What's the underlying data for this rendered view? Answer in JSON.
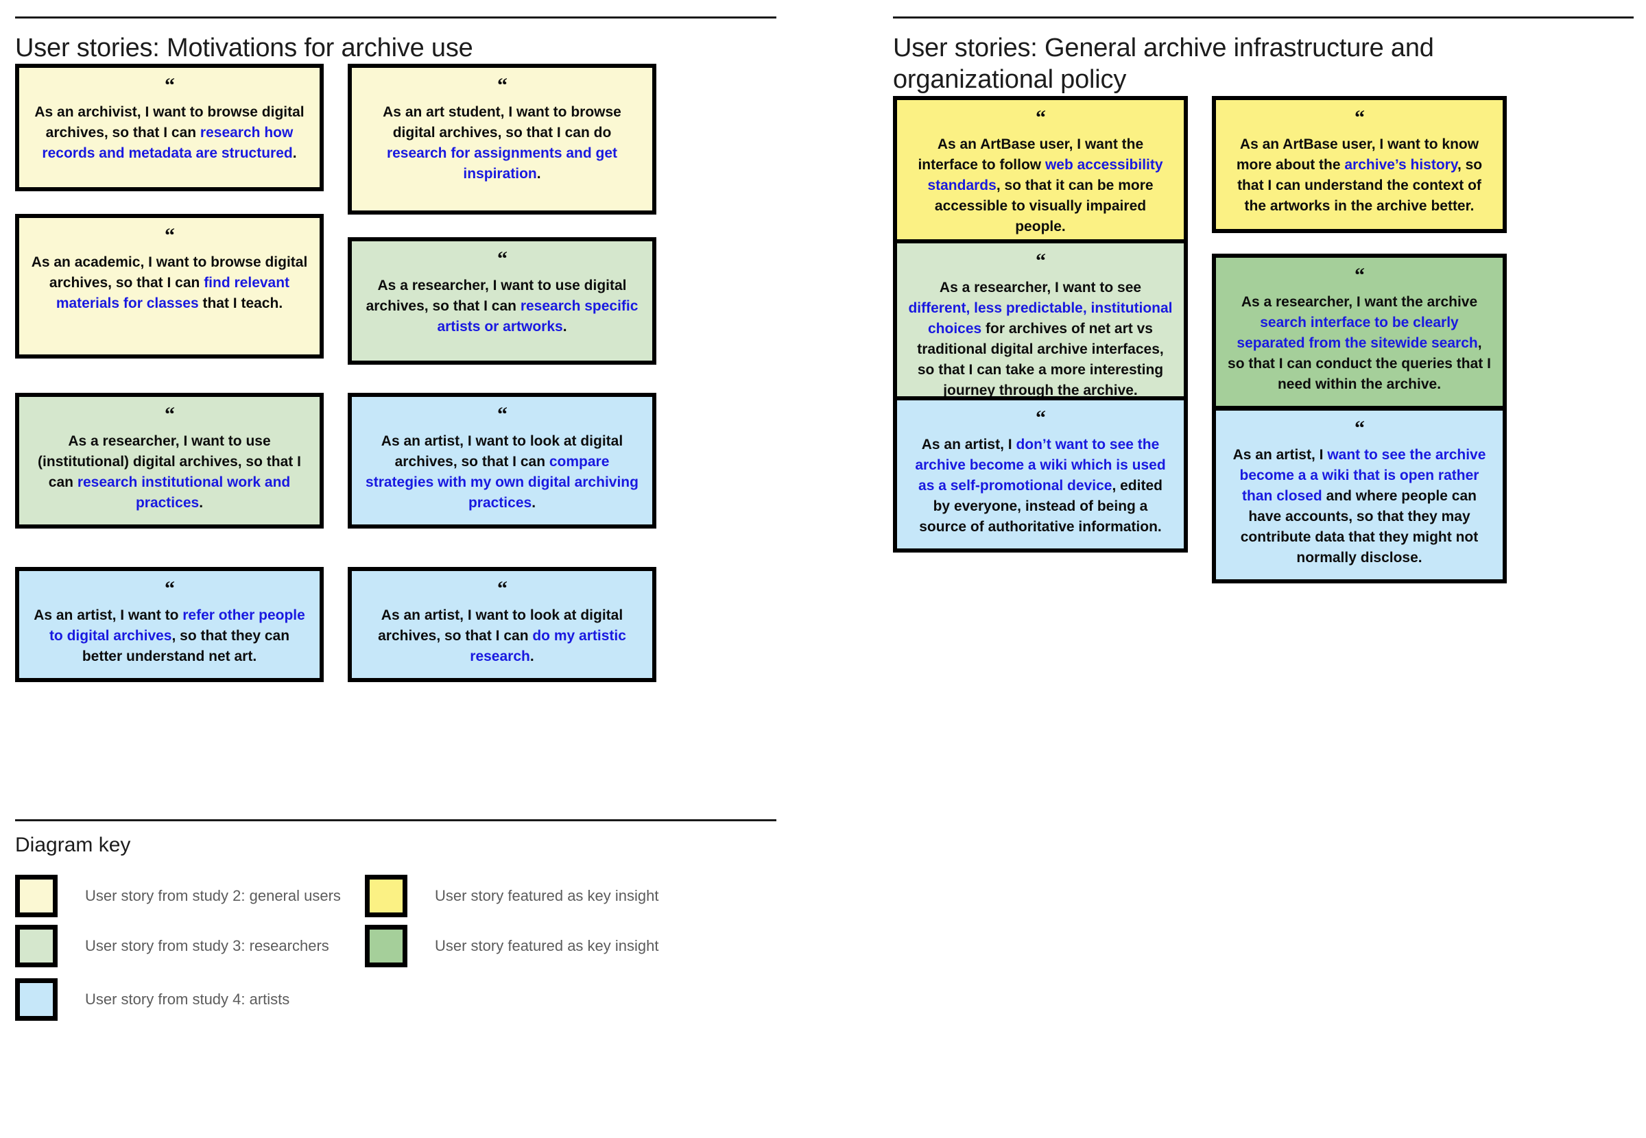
{
  "left_column": {
    "title": "User stories: Motivations for archive use",
    "cards": [
      {
        "id": "archivist-browse",
        "swatch": "cream",
        "quote_icon": "quote-mark-icon",
        "segments": [
          {
            "text": "As an archivist, I want to browse digital archives, so that I can ",
            "highlight": false
          },
          {
            "text": "research how records and metadata are structured",
            "highlight": true
          },
          {
            "text": ".",
            "highlight": false
          }
        ]
      },
      {
        "id": "art-student-browse",
        "swatch": "cream",
        "quote_icon": "quote-mark-icon",
        "segments": [
          {
            "text": "As an art student, I want to browse digital archives, so that I can do ",
            "highlight": false
          },
          {
            "text": "research for assignments and get inspiration",
            "highlight": true
          },
          {
            "text": ".",
            "highlight": false
          }
        ]
      },
      {
        "id": "academic-browse",
        "swatch": "cream",
        "quote_icon": "quote-mark-icon",
        "segments": [
          {
            "text": "As an academic, I want to browse digital archives, so that I can ",
            "highlight": false
          },
          {
            "text": "find relevant materials for classes",
            "highlight": true
          },
          {
            "text": " that I teach.",
            "highlight": false
          }
        ]
      },
      {
        "id": "researcher-specific-artists",
        "swatch": "greenlight",
        "quote_icon": "quote-mark-icon",
        "segments": [
          {
            "text": "As a researcher, I want to use digital archives, so that I can ",
            "highlight": false
          },
          {
            "text": "research specific artists or artworks",
            "highlight": true
          },
          {
            "text": ".",
            "highlight": false
          }
        ]
      },
      {
        "id": "researcher-institutional",
        "swatch": "greenlight",
        "quote_icon": "quote-mark-icon",
        "segments": [
          {
            "text": "As a researcher, I want to use (institutional) digital archives, so that I can ",
            "highlight": false
          },
          {
            "text": "research institutional work and practices",
            "highlight": true
          },
          {
            "text": ".",
            "highlight": false
          }
        ]
      },
      {
        "id": "artist-compare-strategies",
        "swatch": "blue",
        "quote_icon": "quote-mark-icon",
        "segments": [
          {
            "text": "As an artist, I want to look at digital archives, so that I can ",
            "highlight": false
          },
          {
            "text": "compare strategies with my own digital archiving practices",
            "highlight": true
          },
          {
            "text": ".",
            "highlight": false
          }
        ]
      },
      {
        "id": "artist-refer-others",
        "swatch": "blue",
        "quote_icon": "quote-mark-icon",
        "segments": [
          {
            "text": "As an artist, I want to ",
            "highlight": false
          },
          {
            "text": "refer other people to digital archives",
            "highlight": true
          },
          {
            "text": ", so that they can better understand net art.",
            "highlight": false
          }
        ]
      },
      {
        "id": "artist-artistic-research",
        "swatch": "blue",
        "quote_icon": "quote-mark-icon",
        "segments": [
          {
            "text": "As an artist, I want to look at digital archives, so that I can ",
            "highlight": false
          },
          {
            "text": "do my artistic research",
            "highlight": true
          },
          {
            "text": ".",
            "highlight": false
          }
        ]
      }
    ]
  },
  "right_column": {
    "title": "User stories: General archive infrastructure and\norganizational policy",
    "cards": [
      {
        "id": "artbase-accessibility",
        "swatch": "yellow",
        "quote_icon": "quote-mark-icon",
        "segments": [
          {
            "text": "As an ArtBase user, I want the interface to follow ",
            "highlight": false
          },
          {
            "text": "web accessibility standards",
            "highlight": true
          },
          {
            "text": ", so that it can be more accessible to visually impaired people.",
            "highlight": false
          }
        ]
      },
      {
        "id": "artbase-archive-history",
        "swatch": "yellow",
        "quote_icon": "quote-mark-icon",
        "segments": [
          {
            "text": "As an ArtBase user, I want to know more about the ",
            "highlight": false
          },
          {
            "text": "archive’s history",
            "highlight": true
          },
          {
            "text": ", so that I can understand the context of the artworks in the archive better.",
            "highlight": false
          }
        ]
      },
      {
        "id": "researcher-institutional-choices",
        "swatch": "greenlight",
        "quote_icon": "quote-mark-icon",
        "segments": [
          {
            "text": "As a researcher, I want to see ",
            "highlight": false
          },
          {
            "text": "different, less predictable, institutional choices",
            "highlight": true
          },
          {
            "text": " for archives of net art vs traditional digital archive interfaces, so that I can take a more interesting journey through the archive.",
            "highlight": false
          }
        ]
      },
      {
        "id": "researcher-separate-search",
        "swatch": "greendark",
        "quote_icon": "quote-mark-icon",
        "segments": [
          {
            "text": "As a researcher, I want the archive ",
            "highlight": false
          },
          {
            "text": "search interface to be clearly separated from the sitewide search",
            "highlight": true
          },
          {
            "text": ", so that I can conduct the queries that I need within the archive.",
            "highlight": false
          }
        ]
      },
      {
        "id": "artist-no-wiki-selfpromo",
        "swatch": "blue",
        "quote_icon": "quote-mark-icon",
        "segments": [
          {
            "text": "As an artist, I ",
            "highlight": false
          },
          {
            "text": "don’t want to see the archive become a wiki which is used as a self-promotional device",
            "highlight": true
          },
          {
            "text": ", edited by everyone, instead of being a source of authoritative information.",
            "highlight": false
          }
        ]
      },
      {
        "id": "artist-open-wiki",
        "swatch": "blue",
        "quote_icon": "quote-mark-icon",
        "segments": [
          {
            "text": "As an artist, I ",
            "highlight": false
          },
          {
            "text": "want to see the archive become a a wiki that is open rather than closed",
            "highlight": true
          },
          {
            "text": " and where people can have accounts, so that they may contribute data that they might not normally disclose.",
            "highlight": false
          }
        ]
      }
    ]
  },
  "legend": {
    "title": "Diagram key",
    "items": [
      {
        "swatch": "cream",
        "label": "User story from study 2: general users"
      },
      {
        "swatch": "yellow",
        "label": "User story featured as key insight"
      },
      {
        "swatch": "greenlight",
        "label": "User story from study 3: researchers"
      },
      {
        "swatch": "greendark",
        "label": "User story featured as key insight"
      },
      {
        "swatch": "blue",
        "label": "User story from study 4: artists"
      }
    ]
  },
  "colors": {
    "cream": "#fbf8d3",
    "yellow": "#fbf184",
    "green_light": "#d5e7cd",
    "green_dark": "#a5cf9a",
    "blue": "#c6e7f9",
    "highlight_text": "#1919e0",
    "body_text": "#0d0d0d",
    "legend_text": "#5b5b5b",
    "border": "#000000"
  }
}
